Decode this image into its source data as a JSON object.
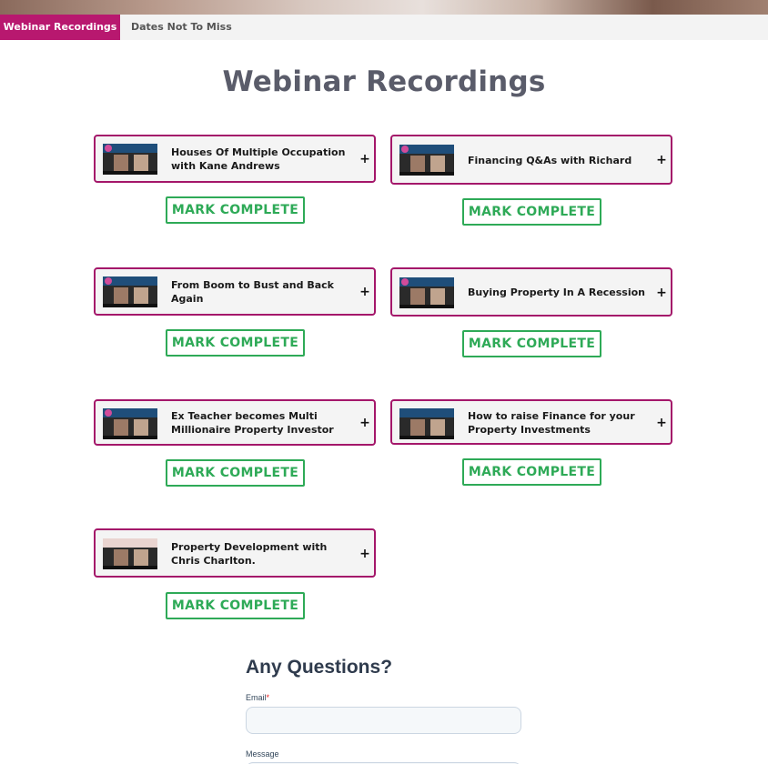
{
  "tabs": [
    {
      "label": "Webinar Recordings",
      "active": true
    },
    {
      "label": "Dates Not To Miss",
      "active": false
    }
  ],
  "page_title": "Webinar Recordings",
  "recordings": [
    {
      "title": "Houses Of Multiple Occupation with Kane Andrews",
      "mark_label": "MARK COMPLETE"
    },
    {
      "title": "Financing Q&As with Richard",
      "mark_label": "MARK COMPLETE"
    },
    {
      "title": "From Boom to Bust and Back Again",
      "mark_label": "MARK COMPLETE"
    },
    {
      "title": "Buying Property In A Recession",
      "mark_label": "MARK COMPLETE"
    },
    {
      "title": "Ex Teacher becomes Multi Millionaire Property Investor",
      "mark_label": "MARK COMPLETE"
    },
    {
      "title": "How to raise Finance for your Property Investments",
      "mark_label": "MARK COMPLETE"
    },
    {
      "title": "Property Development with Chris Charlton.",
      "mark_label": "MARK COMPLETE"
    }
  ],
  "expand_icon": "+",
  "form": {
    "title": "Any Questions?",
    "email_label": "Email",
    "required_marker": "*",
    "email_value": "",
    "message_label": "Message"
  },
  "colors": {
    "accent": "#b8186f",
    "card_border": "#a4176a",
    "complete_green": "#2eaa57",
    "title_gray": "#5a5c6a"
  }
}
